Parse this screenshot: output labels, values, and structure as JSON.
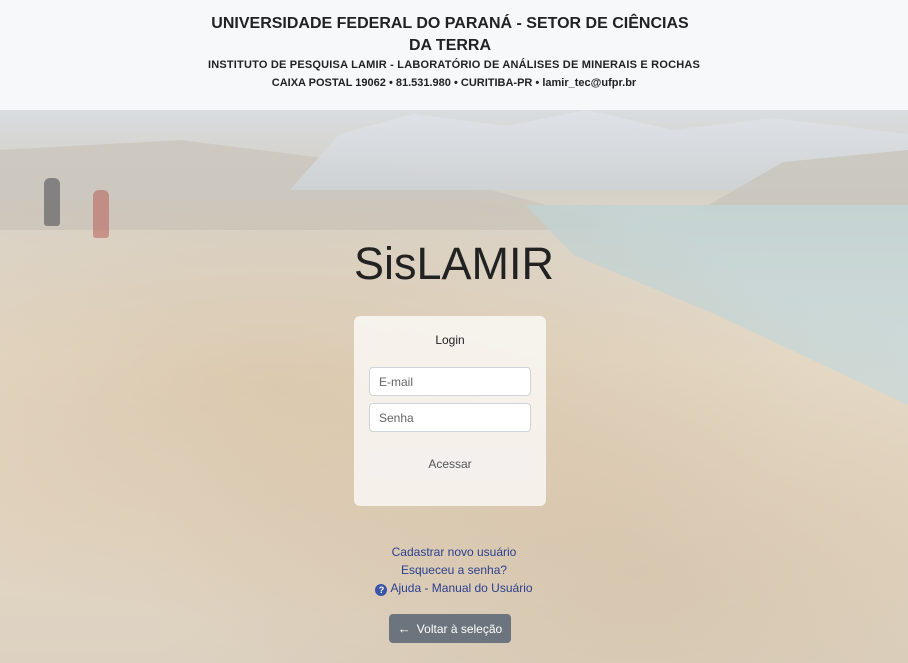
{
  "header": {
    "title": "UNIVERSIDADE FEDERAL DO PARANÁ - SETOR DE CIÊNCIAS DA TERRA",
    "subtitle": "INSTITUTO DE PESQUISA LAMIR - LABORATÓRIO DE ANÁLISES DE MINERAIS E ROCHAS",
    "contact": "CAIXA POSTAL 19062 • 81.531.980 • CURITIBA-PR • lamir_tec@ufpr.br"
  },
  "app_title": "SisLAMIR",
  "login": {
    "title": "Login",
    "email_placeholder": "E-mail",
    "email_value": "",
    "password_placeholder": "Senha",
    "password_value": "",
    "submit_label": "Acessar"
  },
  "links": {
    "register": "Cadastrar novo usuário",
    "forgot": "Esqueceu a senha?",
    "help_icon": "question-circle-icon",
    "help": "Ajuda - Manual do Usuário"
  },
  "back_button": {
    "icon": "arrow-left-icon",
    "label": "Voltar à seleção"
  },
  "colors": {
    "link": "#2b3f8f",
    "back_button_bg": "#6c757d",
    "header_bg": "#f7f8fa"
  }
}
